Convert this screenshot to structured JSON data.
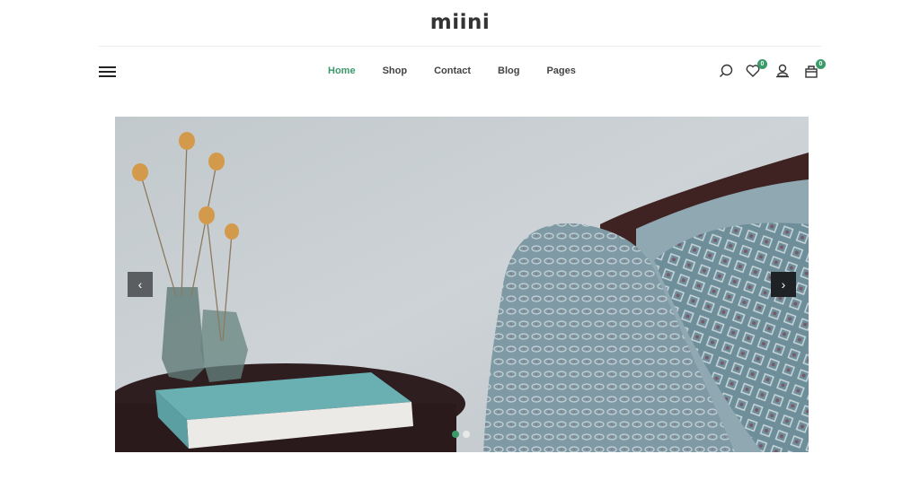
{
  "brand": {
    "logo": "miini",
    "accent": "#3a9a6a"
  },
  "nav": {
    "items": [
      {
        "label": "Home",
        "active": true
      },
      {
        "label": "Shop",
        "active": false
      },
      {
        "label": "Contact",
        "active": false
      },
      {
        "label": "Blog",
        "active": false
      },
      {
        "label": "Pages",
        "active": false
      }
    ],
    "icons": {
      "search": "search-icon",
      "wishlist": {
        "name": "heart-icon",
        "count": "0"
      },
      "account": "user-icon",
      "cart": {
        "name": "cart-icon",
        "count": "0"
      }
    }
  },
  "slider": {
    "image_alt": "Side table with dried flowers in glass vases and a teal book, beside a patterned blue armchair",
    "prev_label": "‹",
    "next_label": "›",
    "slide_count": 2,
    "active_slide": 1
  }
}
